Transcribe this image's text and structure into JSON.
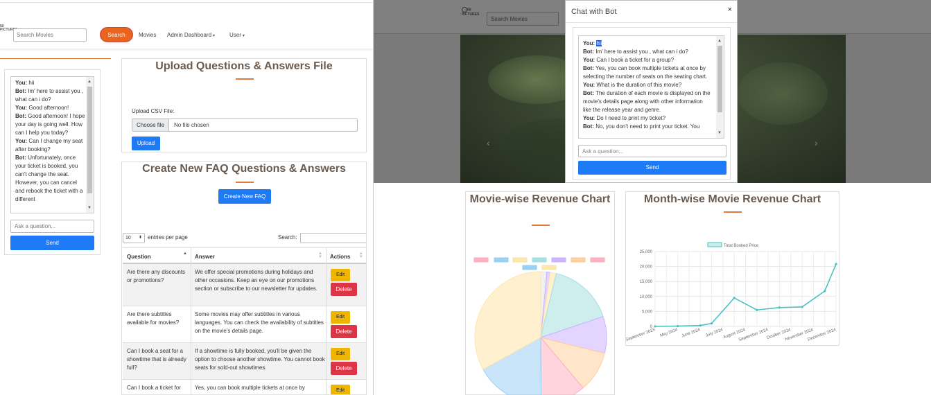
{
  "navbar": {
    "logo_text": "50 PICTURES",
    "search_placeholder": "Search Movies",
    "search_button": "Search",
    "links": [
      {
        "label": "Movies"
      },
      {
        "label": "Admin Dashboard"
      },
      {
        "label": "User"
      }
    ]
  },
  "left_chat": {
    "messages": [
      {
        "speaker": "You:",
        "text": "hii"
      },
      {
        "speaker": "Bot:",
        "text": "Im' here to assist you , what can i do?"
      },
      {
        "speaker": "You:",
        "text": "Good afternoon!"
      },
      {
        "speaker": "Bot:",
        "text": "Good afternoon! I hope your day is going well. How can I help you today?"
      },
      {
        "speaker": "You:",
        "text": "Can I change my seat after booking?"
      },
      {
        "speaker": "Bot:",
        "text": "Unfortunately, once your ticket is booked, you can't change the seat. However, you can cancel and rebook the ticket with a different"
      }
    ],
    "input_placeholder": "Ask a question...",
    "send_label": "Send"
  },
  "upload": {
    "title": "Upload Questions & Answers File",
    "label": "Upload CSV File:",
    "choose_file": "Choose file",
    "no_file": "No file chosen",
    "button": "Upload"
  },
  "faq": {
    "title": "Create New FAQ Questions & Answers",
    "create_button": "Create New FAQ",
    "entries_value": "10",
    "entries_text": "entries per page",
    "search_label": "Search:",
    "columns": [
      "Question",
      "Answer",
      "Actions"
    ],
    "edit_label": "Edit",
    "delete_label": "Delete",
    "rows": [
      {
        "question": "Are there any discounts or promotions?",
        "answer": "We offer special promotions during holidays and other occasions. Keep an eye on our promotions section or subscribe to our newsletter for updates."
      },
      {
        "question": "Are there subtitles available for movies?",
        "answer": "Some movies may offer subtitles in various languages. You can check the availability of subtitles on the movie's details page."
      },
      {
        "question": "Can I book a seat for a showtime that is already full?",
        "answer": "If a showtime is fully booked, you'll be given the option to choose another showtime. You cannot book seats for sold-out showtimes."
      },
      {
        "question": "Can I book a ticket for",
        "answer": "Yes, you can book multiple tickets at once by"
      }
    ]
  },
  "overlay_nav": {
    "logo_text": "50 PICTURES",
    "search_placeholder": "Search Movies"
  },
  "chat_modal": {
    "title": "Chat with Bot",
    "close_glyph": "×",
    "messages": [
      {
        "speaker": "You:",
        "text": "hii",
        "highlight": true
      },
      {
        "speaker": "Bot:",
        "text": "Im' here to assist you , what can i do?"
      },
      {
        "speaker": "You:",
        "text": "Can I book a ticket for a group?"
      },
      {
        "speaker": "Bot:",
        "text": "Yes, you can book multiple tickets at once by selecting the number of seats on the seating chart."
      },
      {
        "speaker": "You:",
        "text": "What is the duration of this movie?"
      },
      {
        "speaker": "Bot:",
        "text": "The duration of each movie is displayed on the movie's details page along with other information like the release year and genre."
      },
      {
        "speaker": "You:",
        "text": "Do I need to print my ticket?"
      },
      {
        "speaker": "Bot:",
        "text": "No, you don't need to print your ticket. You"
      }
    ],
    "input_placeholder": "Ask a question...",
    "send_label": "Send"
  },
  "chart_data": [
    {
      "type": "pie",
      "title": "Movie-wise Revenue Chart",
      "legend_colors": [
        "#ffb1c1",
        "#9ad0f5",
        "#ffe6aa",
        "#a5dfdf",
        "#ccb2ff",
        "#ffcf9f",
        "#ffb1c1",
        "#9ad0f5",
        "#ffe6aa"
      ],
      "slices": [
        {
          "value": 1.5,
          "color": "#e4e4e4"
        },
        {
          "value": 0.8,
          "color": "#ccb2ff"
        },
        {
          "value": 1.5,
          "color": "#ffe6aa"
        },
        {
          "value": 16,
          "color": "#a5dfdf"
        },
        {
          "value": 9,
          "color": "#ccb2ff"
        },
        {
          "value": 10,
          "color": "#ffcf9f"
        },
        {
          "value": 11,
          "color": "#ffb1c1"
        },
        {
          "value": 17,
          "color": "#9ad0f5"
        },
        {
          "value": 33,
          "color": "#ffe6aa"
        }
      ]
    },
    {
      "type": "line",
      "title": "Month-wise Movie Revenue Chart",
      "series": [
        {
          "name": "Total Booked Price",
          "color": "#4bc0c0",
          "values": [
            0,
            100,
            300,
            1000,
            9500,
            5500,
            6300,
            6500,
            11800,
            20800
          ]
        }
      ],
      "categories": [
        "September 2023",
        "",
        "May 2024",
        "",
        "June 2024",
        "",
        "July 2024",
        "",
        "August 2024",
        "",
        "September 2024",
        "",
        "October 2024",
        "",
        "November 2024",
        "",
        "December 2024"
      ],
      "x_tick_labels": [
        "September 2023",
        "May 2024",
        "June 2024",
        "July 2024",
        "August 2024",
        "September 2024",
        "October 2024",
        "November 2024",
        "December 2024"
      ],
      "y_ticks": [
        "0",
        "5,000",
        "10,000",
        "15,000",
        "20,000",
        "25,000"
      ],
      "ylim": [
        0,
        25000
      ],
      "grid": true,
      "legend": "top"
    }
  ]
}
